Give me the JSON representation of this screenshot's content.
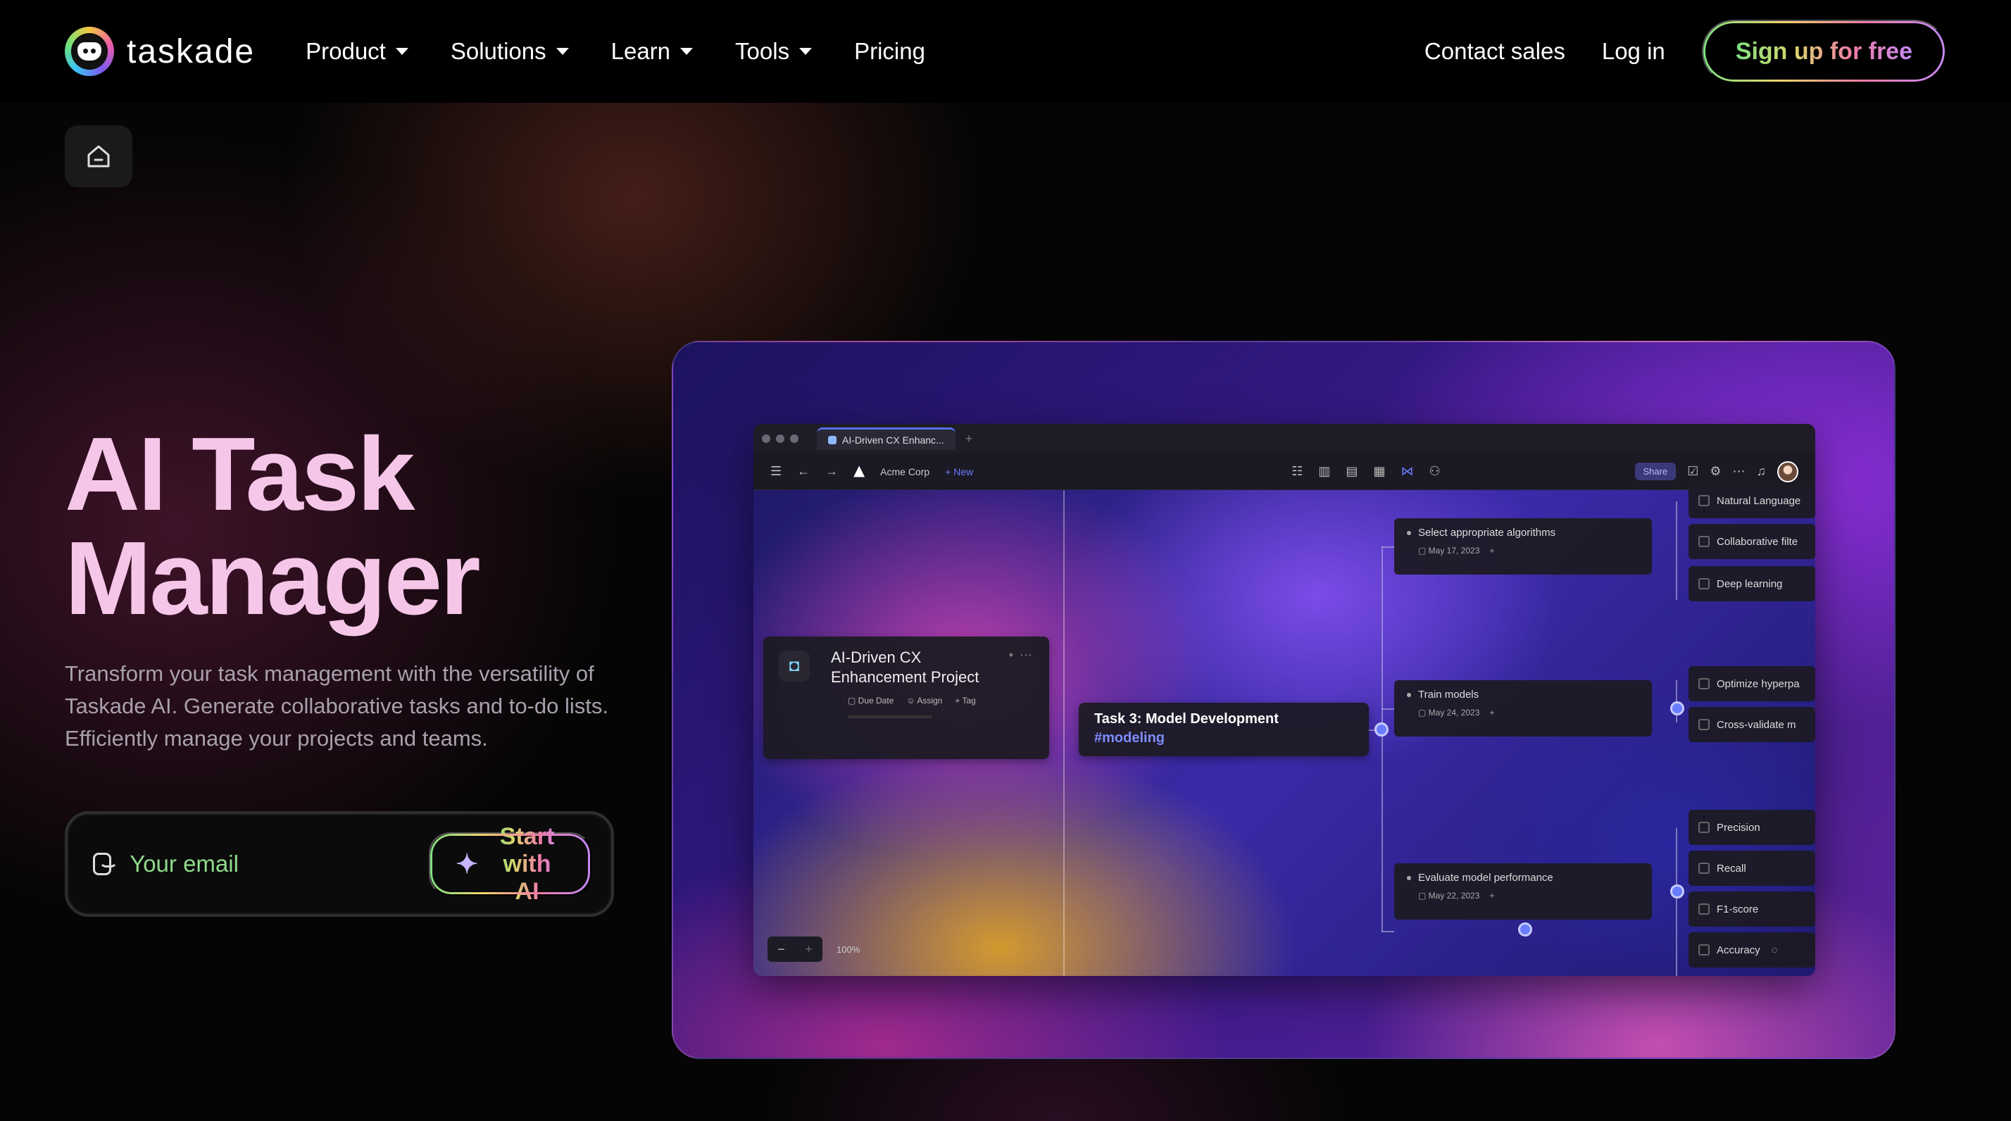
{
  "nav": {
    "logo_text": "taskade",
    "links": [
      {
        "label": "Product",
        "dropdown": true
      },
      {
        "label": "Solutions",
        "dropdown": true
      },
      {
        "label": "Learn",
        "dropdown": true
      },
      {
        "label": "Tools",
        "dropdown": true
      },
      {
        "label": "Pricing",
        "dropdown": false
      }
    ],
    "contact_sales": "Contact sales",
    "login": "Log in",
    "signup": "Sign up for free"
  },
  "hero": {
    "title_line1": "AI Task",
    "title_line2": "Manager",
    "subtitle": "Transform your task management with the versatility of Taskade AI. Generate collaborative tasks and to-do lists. Efficiently manage your projects and teams.",
    "email_placeholder": "Your email",
    "cta": "Start with AI"
  },
  "preview": {
    "tab_title": "AI-Driven CX Enhanc...",
    "workspace": "Acme Corp",
    "new_label": "New",
    "share_label": "Share",
    "project_title": "AI-Driven CX Enhancement Project",
    "project_meta": {
      "due": "Due Date",
      "assign": "Assign",
      "tag": "Tag"
    },
    "task_title": "Task 3: Model Development",
    "task_tag": "#modeling",
    "subtasks": [
      {
        "label": "Select appropriate algorithms",
        "date": "May 17, 2023"
      },
      {
        "label": "Train models",
        "date": "May 24, 2023"
      },
      {
        "label": "Evaluate model performance",
        "date": "May 22, 2023"
      }
    ],
    "leaves": [
      "Natural Language",
      "Collaborative filte",
      "Deep learning",
      "Optimize hyperpa",
      "Cross-validate m",
      "Precision",
      "Recall",
      "F1-score",
      "Accuracy"
    ],
    "zoom": "100%"
  },
  "colors": {
    "title_pink": "#f6c6e8",
    "accent_indigo": "#6a7cff",
    "gradient": [
      "#7ee081",
      "#f5d36b",
      "#ef7aa8",
      "#c58af5"
    ]
  }
}
